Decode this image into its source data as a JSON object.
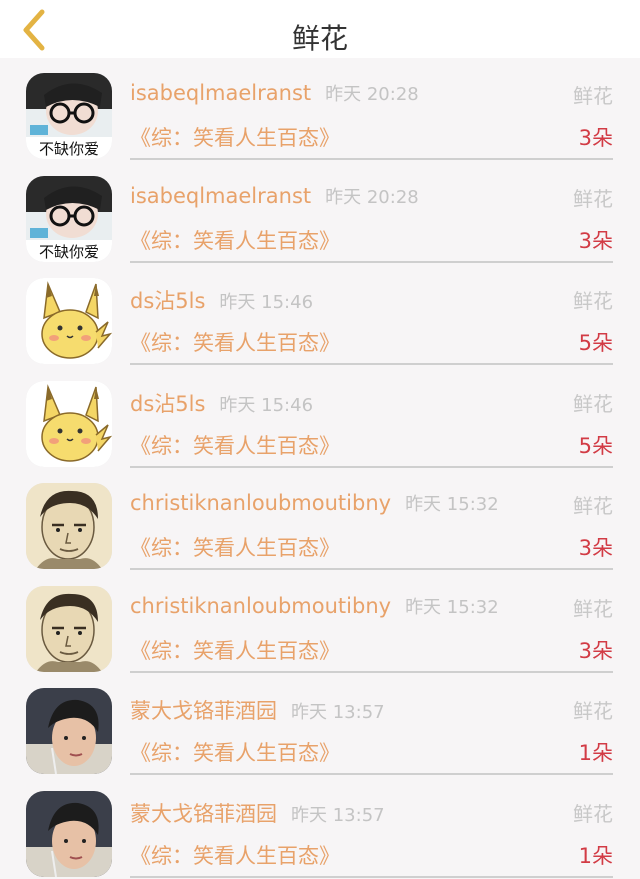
{
  "header": {
    "title": "鲜花",
    "back_icon": "chevron-left-icon",
    "accent": "#e3b343"
  },
  "colors": {
    "name": "#e8a26a",
    "count": "#d23b45",
    "muted": "#c4c4c4"
  },
  "items": [
    {
      "user": "isabeqlmaelranst",
      "time": "昨天 20:28",
      "gift": "鲜花",
      "show": "《综：笑看人生百态》",
      "count": "3朵",
      "avatar": "avatar-girl-glasses",
      "avatar_caption": "不缺你爱"
    },
    {
      "user": "isabeqlmaelranst",
      "time": "昨天 20:28",
      "gift": "鲜花",
      "show": "《综：笑看人生百态》",
      "count": "3朵",
      "avatar": "avatar-girl-glasses",
      "avatar_caption": "不缺你爱"
    },
    {
      "user": "ds沾5ls",
      "time": "昨天 15:46",
      "gift": "鲜花",
      "show": "《综：笑看人生百态》",
      "count": "5朵",
      "avatar": "avatar-yellow-creature",
      "avatar_caption": ""
    },
    {
      "user": "ds沾5ls",
      "time": "昨天 15:46",
      "gift": "鲜花",
      "show": "《综：笑看人生百态》",
      "count": "5朵",
      "avatar": "avatar-yellow-creature",
      "avatar_caption": ""
    },
    {
      "user": "christiknanloubmoutibny",
      "time": "昨天 15:32",
      "gift": "鲜花",
      "show": "《综：笑看人生百态》",
      "count": "3朵",
      "avatar": "avatar-sketch-face",
      "avatar_caption": ""
    },
    {
      "user": "christiknanloubmoutibny",
      "time": "昨天 15:32",
      "gift": "鲜花",
      "show": "《综：笑看人生百态》",
      "count": "3朵",
      "avatar": "avatar-sketch-face",
      "avatar_caption": ""
    },
    {
      "user": "蒙大戈铬菲酒园",
      "time": "昨天 13:57",
      "gift": "鲜花",
      "show": "《综：笑看人生百态》",
      "count": "1朵",
      "avatar": "avatar-young-man",
      "avatar_caption": ""
    },
    {
      "user": "蒙大戈铬菲酒园",
      "time": "昨天 13:57",
      "gift": "鲜花",
      "show": "《综：笑看人生百态》",
      "count": "1朵",
      "avatar": "avatar-young-man",
      "avatar_caption": ""
    }
  ]
}
